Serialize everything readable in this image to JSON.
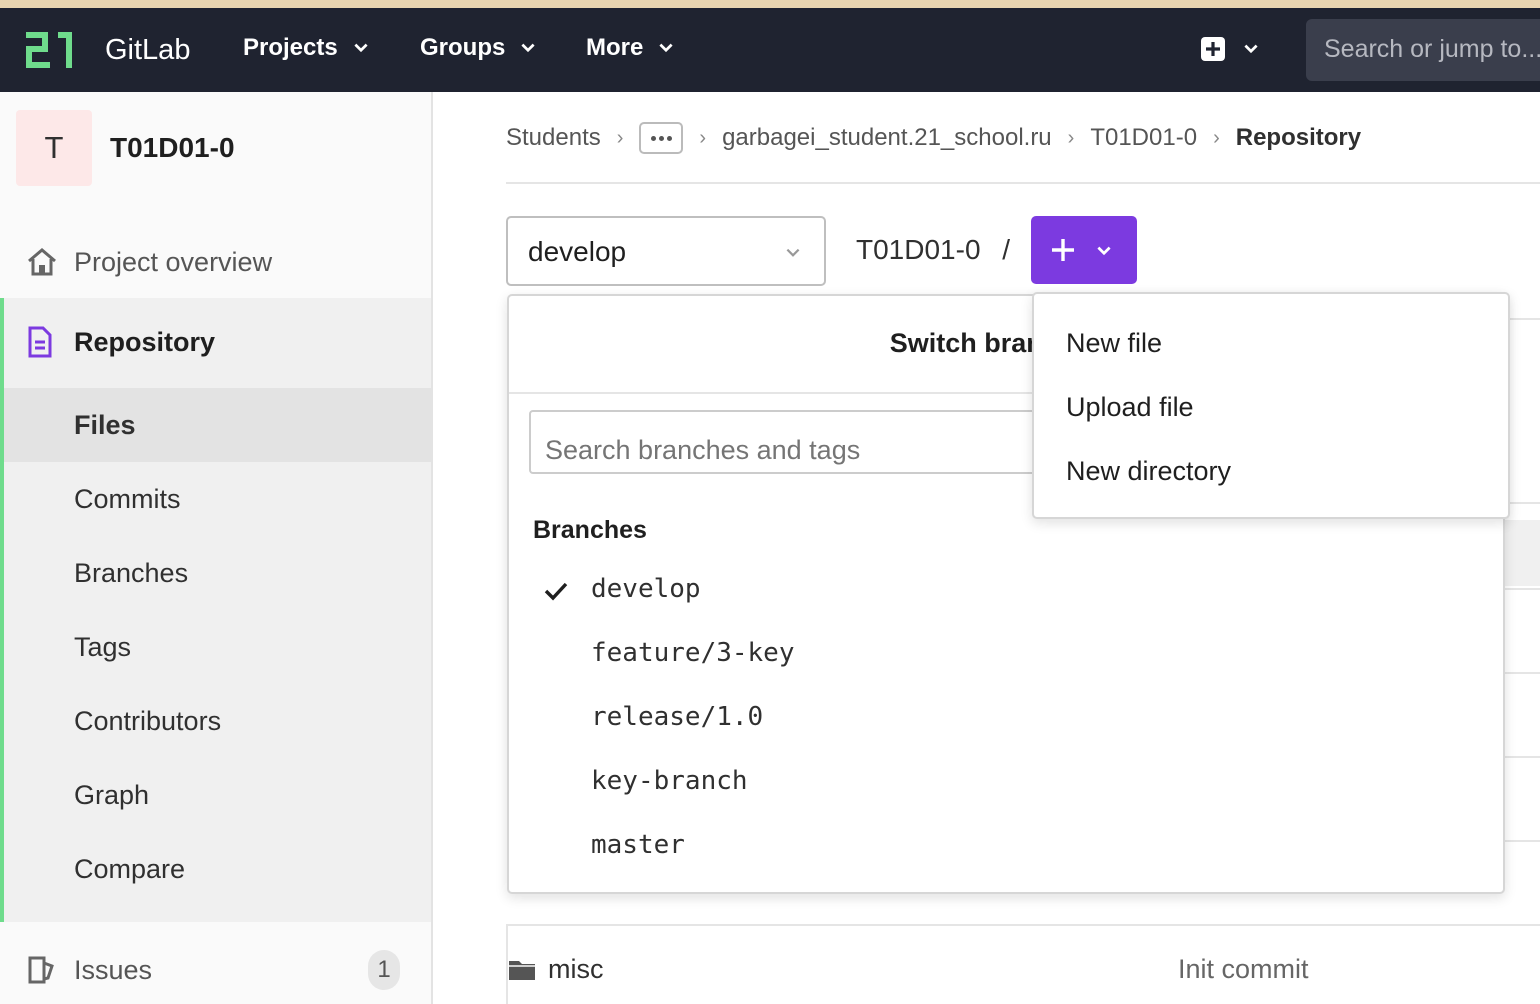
{
  "navbar": {
    "brand": "GitLab",
    "projects": "Projects",
    "groups": "Groups",
    "more": "More",
    "search_placeholder": "Search or jump to..."
  },
  "sidebar": {
    "project_initial": "T",
    "project_name": "T01D01-0",
    "overview": "Project overview",
    "repository": "Repository",
    "sub_items": [
      "Files",
      "Commits",
      "Branches",
      "Tags",
      "Contributors",
      "Graph",
      "Compare"
    ],
    "issues": "Issues",
    "issues_count": "1"
  },
  "breadcrumb": {
    "students": "Students",
    "user": "garbagei_student.21_school.ru",
    "project": "T01D01-0",
    "current": "Repository"
  },
  "repo": {
    "branch": "develop",
    "path": "T01D01-0",
    "path_sep": "/"
  },
  "branch_dropdown": {
    "title": "Switch branch/tag",
    "search_placeholder": "Search branches and tags",
    "header": "Branches",
    "items": [
      "develop",
      "feature/3-key",
      "release/1.0",
      "key-branch",
      "master"
    ],
    "selected": "develop"
  },
  "new_menu": {
    "items": [
      "New file",
      "Upload file",
      "New directory"
    ]
  },
  "files": {
    "misc_name": "misc",
    "misc_commit": "Init commit"
  },
  "colors": {
    "navbar": "#1f2330",
    "accent": "#7c3ae0",
    "logo": "#6fdc8c"
  }
}
